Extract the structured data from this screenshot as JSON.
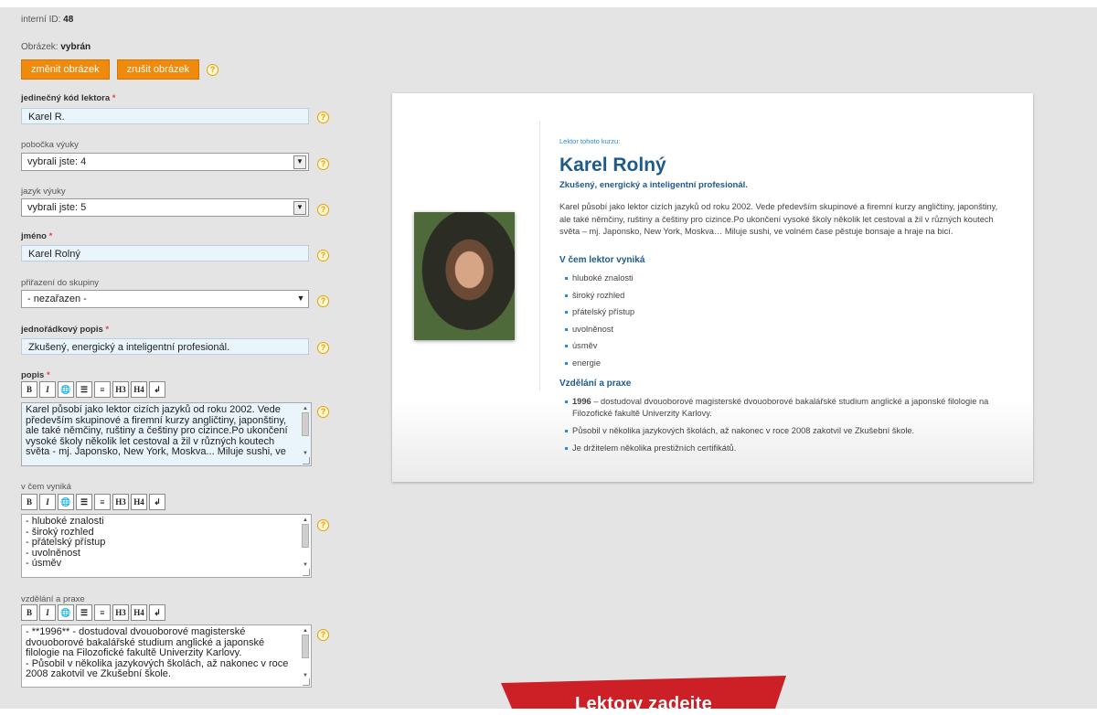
{
  "meta": {
    "internal_id_label": "interní ID:",
    "internal_id": "48",
    "image_label": "Obrázek:",
    "image_value": "vybrán"
  },
  "buttons": {
    "change_image": "změnit obrázek",
    "cancel_image": "zrušit obrázek"
  },
  "help_symbol": "?",
  "required_mark": "*",
  "fields": {
    "code": {
      "label": "jedinečný kód lektora",
      "value": "Karel R."
    },
    "branch": {
      "label": "pobočka výuky",
      "value": "vybrali jste: 4"
    },
    "language": {
      "label": "jazyk výuky",
      "value": "vybrali jste: 5"
    },
    "name": {
      "label": "jméno",
      "value": "Karel Rolný"
    },
    "group": {
      "label": "přiřazení do skupiny",
      "value": "- nezařazen -"
    },
    "oneliner": {
      "label": "jednořádkový popis",
      "value": "Zkušený, energický a inteligentní profesionál."
    },
    "description": {
      "label": "popis",
      "lines": [
        "Karel působí jako lektor cizích jazyků od roku 2002. Vede",
        "především skupinové a firemní kurzy angličtiny, japonštiny,",
        "ale také němčiny, ruštiny a češtiny pro cizince.Po ukončení",
        "vysoké školy několik let cestoval a žil v různých koutech",
        "světa - mj. Japonsko, New York, Moskva... Miluje sushi, ve"
      ]
    },
    "strengths": {
      "label": "v čem vyniká",
      "lines": [
        "- hluboké znalosti",
        "- široký rozhled",
        "- přátelský přístup",
        "- uvolněnost",
        "- úsměv"
      ]
    },
    "education": {
      "label": "vzdělání a praxe",
      "lines": [
        "- **1996** - dostudoval dvouoborové magisterské",
        "dvouoborové bakalářské studium anglické a japonské",
        "filologie na Filozofické fakultě Univerzity Karlovy.",
        "- Působil v několika jazykových školách, až nakonec v roce",
        "2008 zakotvil ve Zkušební škole."
      ]
    }
  },
  "toolbar": [
    "B",
    "I",
    "🌐",
    "☰",
    "≡",
    "H3",
    "H4",
    "↲"
  ],
  "preview": {
    "kicker": "Lektor tohoto kurzu:",
    "name": "Karel Rolný",
    "tagline": "Zkušený, energický a inteligentní profesionál.",
    "bio_lines": [
      "Karel působí jako lektor cizích jazyků od roku 2002. Vede především skupinové a firemní kurzy angličtiny, japonštiny,",
      "ale také němčiny, ruštiny a češtiny pro cizince.Po ukončení vysoké školy několik let cestoval a žil v různých koutech",
      "světa – mj. Japonsko, New York, Moskva… Miluje sushi, ve volném čase pěstuje bonsaje a hraje na bicí."
    ],
    "strengths_title": "V čem lektor vyniká",
    "strengths": [
      "hluboké znalosti",
      "široký rozhled",
      "přátelský přístup",
      "uvolněnost",
      "úsměv",
      "energie"
    ],
    "education_title": "Vzdělání a praxe",
    "education_year": "1996",
    "education_item1": " – dostudoval dvouoborové magisterské dvouoborové bakalářské studium anglické a japonské filologie na Filozofické fakultě Univerzity Karlovy.",
    "education_item2": "Působil v několika jazykových školách, až nakonec v roce 2008 zakotvil ve Zkušební škole.",
    "education_item3": "Je držitelem několika prestižních certifikátů."
  },
  "banner": {
    "text": "Lektory zadejte",
    "color": "#cc1f26"
  },
  "colors": {
    "accent_orange": "#ef8a0c",
    "heading_blue": "#1e5a8c",
    "input_tint": "#e9f4fb",
    "background": "#e4e4e4"
  }
}
